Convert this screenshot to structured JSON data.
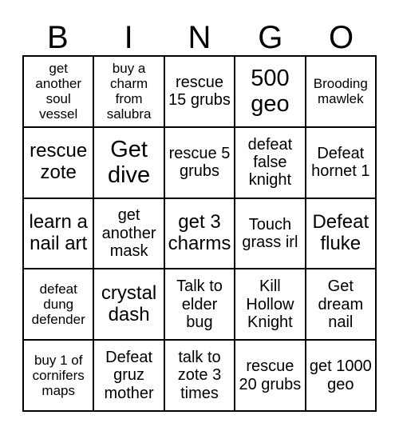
{
  "card": {
    "header": {
      "letters": [
        {
          "label": "B"
        },
        {
          "label": "I"
        },
        {
          "label": "N"
        },
        {
          "label": "G"
        },
        {
          "label": "O"
        }
      ]
    },
    "colors": {
      "background": "#ffffff",
      "text": "#000000",
      "grid_line": "#000000"
    },
    "grid": {
      "rows": 5,
      "columns": 5,
      "cells": [
        {
          "text": "get another soul vessel",
          "size": "fs-sm"
        },
        {
          "text": "buy a charm from salubra",
          "size": "fs-sm"
        },
        {
          "text": "rescue 15 grubs",
          "size": "fs-md"
        },
        {
          "text": "500 geo",
          "size": "fs-xl"
        },
        {
          "text": "Brooding mawlek",
          "size": "fs-sm"
        },
        {
          "text": "rescue zote",
          "size": "fs-lg"
        },
        {
          "text": "Get dive",
          "size": "fs-xl"
        },
        {
          "text": "rescue 5 grubs",
          "size": "fs-md"
        },
        {
          "text": "defeat false knight",
          "size": "fs-md"
        },
        {
          "text": "Defeat hornet 1",
          "size": "fs-md"
        },
        {
          "text": "learn a nail art",
          "size": "fs-lg"
        },
        {
          "text": "get another mask",
          "size": "fs-md"
        },
        {
          "text": "get 3 charms",
          "size": "fs-lg"
        },
        {
          "text": "Touch grass irl",
          "size": "fs-md"
        },
        {
          "text": "Defeat fluke",
          "size": "fs-lg"
        },
        {
          "text": "defeat dung defender",
          "size": "fs-sm"
        },
        {
          "text": "crystal dash",
          "size": "fs-lg"
        },
        {
          "text": "Talk to elder bug",
          "size": "fs-md"
        },
        {
          "text": "Kill Hollow Knight",
          "size": "fs-md"
        },
        {
          "text": "Get dream nail",
          "size": "fs-md"
        },
        {
          "text": "buy 1 of cornifers maps",
          "size": "fs-sm"
        },
        {
          "text": "Defeat gruz mother",
          "size": "fs-md"
        },
        {
          "text": "talk to zote 3 times",
          "size": "fs-md"
        },
        {
          "text": "rescue 20 grubs",
          "size": "fs-md"
        },
        {
          "text": "get 1000 geo",
          "size": "fs-md"
        }
      ]
    }
  }
}
